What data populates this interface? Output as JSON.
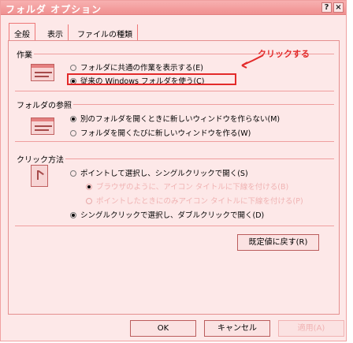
{
  "title_bar": {
    "title": "フォルダ オプション",
    "help_label": "?",
    "close_label": "×"
  },
  "tabs": [
    {
      "label": "全般"
    },
    {
      "label": "表示"
    },
    {
      "label": "ファイルの種類"
    }
  ],
  "tasks": {
    "title": "作業",
    "options": [
      {
        "label": "フォルダに共通の作業を表示する(E)",
        "selected": false
      },
      {
        "label": "従来の Windows フォルダを使う(C)",
        "selected": true
      }
    ]
  },
  "browse": {
    "title": "フォルダの参照",
    "options": [
      {
        "label": "別のフォルダを開くときに新しいウィンドウを作らない(M)",
        "selected": true
      },
      {
        "label": "フォルダを開くたびに新しいウィンドウを作る(W)",
        "selected": false
      }
    ]
  },
  "click": {
    "title": "クリック方法",
    "options": [
      {
        "label": "ポイントして選択し、シングルクリックで開く(S)",
        "selected": false
      },
      {
        "label": "ブラウザのように、アイコン タイトルに下線を付ける(B)",
        "selected": true,
        "disabled": true
      },
      {
        "label": "ポイントしたときにのみアイコン タイトルに下線を付ける(P)",
        "selected": false,
        "disabled": true
      },
      {
        "label": "シングルクリックで選択し、ダブルクリックで開く(D)",
        "selected": true
      }
    ]
  },
  "restore_button": "既定値に戻す(R)",
  "footer": {
    "ok": "OK",
    "cancel": "キャンセル",
    "apply": "適用(A)"
  },
  "annotation": {
    "text": "クリックする"
  }
}
